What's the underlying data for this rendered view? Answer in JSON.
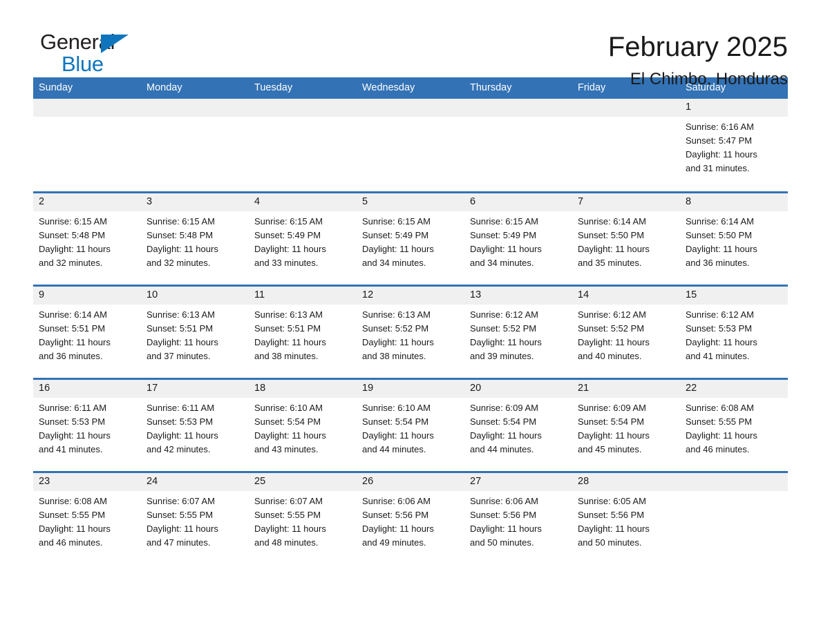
{
  "logo": {
    "word1": "General",
    "word2": "Blue",
    "triangle_color": "#0f75bc",
    "word1_color": "#231f20",
    "word2_color": "#0f75bc"
  },
  "header": {
    "month_title": "February 2025",
    "location": "El Chimbo, Honduras",
    "accent_color": "#3372b5"
  },
  "weekdays": [
    "Sunday",
    "Monday",
    "Tuesday",
    "Wednesday",
    "Thursday",
    "Friday",
    "Saturday"
  ],
  "labels": {
    "sunrise": "Sunrise:",
    "sunset": "Sunset:",
    "daylight": "Daylight:"
  },
  "weeks": [
    [
      {
        "day": "",
        "sunrise": "",
        "sunset": "",
        "daylight_line1": "",
        "daylight_line2": "",
        "blank": true
      },
      {
        "day": "",
        "sunrise": "",
        "sunset": "",
        "daylight_line1": "",
        "daylight_line2": "",
        "blank": true
      },
      {
        "day": "",
        "sunrise": "",
        "sunset": "",
        "daylight_line1": "",
        "daylight_line2": "",
        "blank": true
      },
      {
        "day": "",
        "sunrise": "",
        "sunset": "",
        "daylight_line1": "",
        "daylight_line2": "",
        "blank": true
      },
      {
        "day": "",
        "sunrise": "",
        "sunset": "",
        "daylight_line1": "",
        "daylight_line2": "",
        "blank": true
      },
      {
        "day": "",
        "sunrise": "",
        "sunset": "",
        "daylight_line1": "",
        "daylight_line2": "",
        "blank": true
      },
      {
        "day": "1",
        "sunrise": "Sunrise: 6:16 AM",
        "sunset": "Sunset: 5:47 PM",
        "daylight_line1": "Daylight: 11 hours",
        "daylight_line2": "and 31 minutes.",
        "blank": false
      }
    ],
    [
      {
        "day": "2",
        "sunrise": "Sunrise: 6:15 AM",
        "sunset": "Sunset: 5:48 PM",
        "daylight_line1": "Daylight: 11 hours",
        "daylight_line2": "and 32 minutes.",
        "blank": false
      },
      {
        "day": "3",
        "sunrise": "Sunrise: 6:15 AM",
        "sunset": "Sunset: 5:48 PM",
        "daylight_line1": "Daylight: 11 hours",
        "daylight_line2": "and 32 minutes.",
        "blank": false
      },
      {
        "day": "4",
        "sunrise": "Sunrise: 6:15 AM",
        "sunset": "Sunset: 5:49 PM",
        "daylight_line1": "Daylight: 11 hours",
        "daylight_line2": "and 33 minutes.",
        "blank": false
      },
      {
        "day": "5",
        "sunrise": "Sunrise: 6:15 AM",
        "sunset": "Sunset: 5:49 PM",
        "daylight_line1": "Daylight: 11 hours",
        "daylight_line2": "and 34 minutes.",
        "blank": false
      },
      {
        "day": "6",
        "sunrise": "Sunrise: 6:15 AM",
        "sunset": "Sunset: 5:49 PM",
        "daylight_line1": "Daylight: 11 hours",
        "daylight_line2": "and 34 minutes.",
        "blank": false
      },
      {
        "day": "7",
        "sunrise": "Sunrise: 6:14 AM",
        "sunset": "Sunset: 5:50 PM",
        "daylight_line1": "Daylight: 11 hours",
        "daylight_line2": "and 35 minutes.",
        "blank": false
      },
      {
        "day": "8",
        "sunrise": "Sunrise: 6:14 AM",
        "sunset": "Sunset: 5:50 PM",
        "daylight_line1": "Daylight: 11 hours",
        "daylight_line2": "and 36 minutes.",
        "blank": false
      }
    ],
    [
      {
        "day": "9",
        "sunrise": "Sunrise: 6:14 AM",
        "sunset": "Sunset: 5:51 PM",
        "daylight_line1": "Daylight: 11 hours",
        "daylight_line2": "and 36 minutes.",
        "blank": false
      },
      {
        "day": "10",
        "sunrise": "Sunrise: 6:13 AM",
        "sunset": "Sunset: 5:51 PM",
        "daylight_line1": "Daylight: 11 hours",
        "daylight_line2": "and 37 minutes.",
        "blank": false
      },
      {
        "day": "11",
        "sunrise": "Sunrise: 6:13 AM",
        "sunset": "Sunset: 5:51 PM",
        "daylight_line1": "Daylight: 11 hours",
        "daylight_line2": "and 38 minutes.",
        "blank": false
      },
      {
        "day": "12",
        "sunrise": "Sunrise: 6:13 AM",
        "sunset": "Sunset: 5:52 PM",
        "daylight_line1": "Daylight: 11 hours",
        "daylight_line2": "and 38 minutes.",
        "blank": false
      },
      {
        "day": "13",
        "sunrise": "Sunrise: 6:12 AM",
        "sunset": "Sunset: 5:52 PM",
        "daylight_line1": "Daylight: 11 hours",
        "daylight_line2": "and 39 minutes.",
        "blank": false
      },
      {
        "day": "14",
        "sunrise": "Sunrise: 6:12 AM",
        "sunset": "Sunset: 5:52 PM",
        "daylight_line1": "Daylight: 11 hours",
        "daylight_line2": "and 40 minutes.",
        "blank": false
      },
      {
        "day": "15",
        "sunrise": "Sunrise: 6:12 AM",
        "sunset": "Sunset: 5:53 PM",
        "daylight_line1": "Daylight: 11 hours",
        "daylight_line2": "and 41 minutes.",
        "blank": false
      }
    ],
    [
      {
        "day": "16",
        "sunrise": "Sunrise: 6:11 AM",
        "sunset": "Sunset: 5:53 PM",
        "daylight_line1": "Daylight: 11 hours",
        "daylight_line2": "and 41 minutes.",
        "blank": false
      },
      {
        "day": "17",
        "sunrise": "Sunrise: 6:11 AM",
        "sunset": "Sunset: 5:53 PM",
        "daylight_line1": "Daylight: 11 hours",
        "daylight_line2": "and 42 minutes.",
        "blank": false
      },
      {
        "day": "18",
        "sunrise": "Sunrise: 6:10 AM",
        "sunset": "Sunset: 5:54 PM",
        "daylight_line1": "Daylight: 11 hours",
        "daylight_line2": "and 43 minutes.",
        "blank": false
      },
      {
        "day": "19",
        "sunrise": "Sunrise: 6:10 AM",
        "sunset": "Sunset: 5:54 PM",
        "daylight_line1": "Daylight: 11 hours",
        "daylight_line2": "and 44 minutes.",
        "blank": false
      },
      {
        "day": "20",
        "sunrise": "Sunrise: 6:09 AM",
        "sunset": "Sunset: 5:54 PM",
        "daylight_line1": "Daylight: 11 hours",
        "daylight_line2": "and 44 minutes.",
        "blank": false
      },
      {
        "day": "21",
        "sunrise": "Sunrise: 6:09 AM",
        "sunset": "Sunset: 5:54 PM",
        "daylight_line1": "Daylight: 11 hours",
        "daylight_line2": "and 45 minutes.",
        "blank": false
      },
      {
        "day": "22",
        "sunrise": "Sunrise: 6:08 AM",
        "sunset": "Sunset: 5:55 PM",
        "daylight_line1": "Daylight: 11 hours",
        "daylight_line2": "and 46 minutes.",
        "blank": false
      }
    ],
    [
      {
        "day": "23",
        "sunrise": "Sunrise: 6:08 AM",
        "sunset": "Sunset: 5:55 PM",
        "daylight_line1": "Daylight: 11 hours",
        "daylight_line2": "and 46 minutes.",
        "blank": false
      },
      {
        "day": "24",
        "sunrise": "Sunrise: 6:07 AM",
        "sunset": "Sunset: 5:55 PM",
        "daylight_line1": "Daylight: 11 hours",
        "daylight_line2": "and 47 minutes.",
        "blank": false
      },
      {
        "day": "25",
        "sunrise": "Sunrise: 6:07 AM",
        "sunset": "Sunset: 5:55 PM",
        "daylight_line1": "Daylight: 11 hours",
        "daylight_line2": "and 48 minutes.",
        "blank": false
      },
      {
        "day": "26",
        "sunrise": "Sunrise: 6:06 AM",
        "sunset": "Sunset: 5:56 PM",
        "daylight_line1": "Daylight: 11 hours",
        "daylight_line2": "and 49 minutes.",
        "blank": false
      },
      {
        "day": "27",
        "sunrise": "Sunrise: 6:06 AM",
        "sunset": "Sunset: 5:56 PM",
        "daylight_line1": "Daylight: 11 hours",
        "daylight_line2": "and 50 minutes.",
        "blank": false
      },
      {
        "day": "28",
        "sunrise": "Sunrise: 6:05 AM",
        "sunset": "Sunset: 5:56 PM",
        "daylight_line1": "Daylight: 11 hours",
        "daylight_line2": "and 50 minutes.",
        "blank": false
      },
      {
        "day": "",
        "sunrise": "",
        "sunset": "",
        "daylight_line1": "",
        "daylight_line2": "",
        "blank": true
      }
    ]
  ]
}
